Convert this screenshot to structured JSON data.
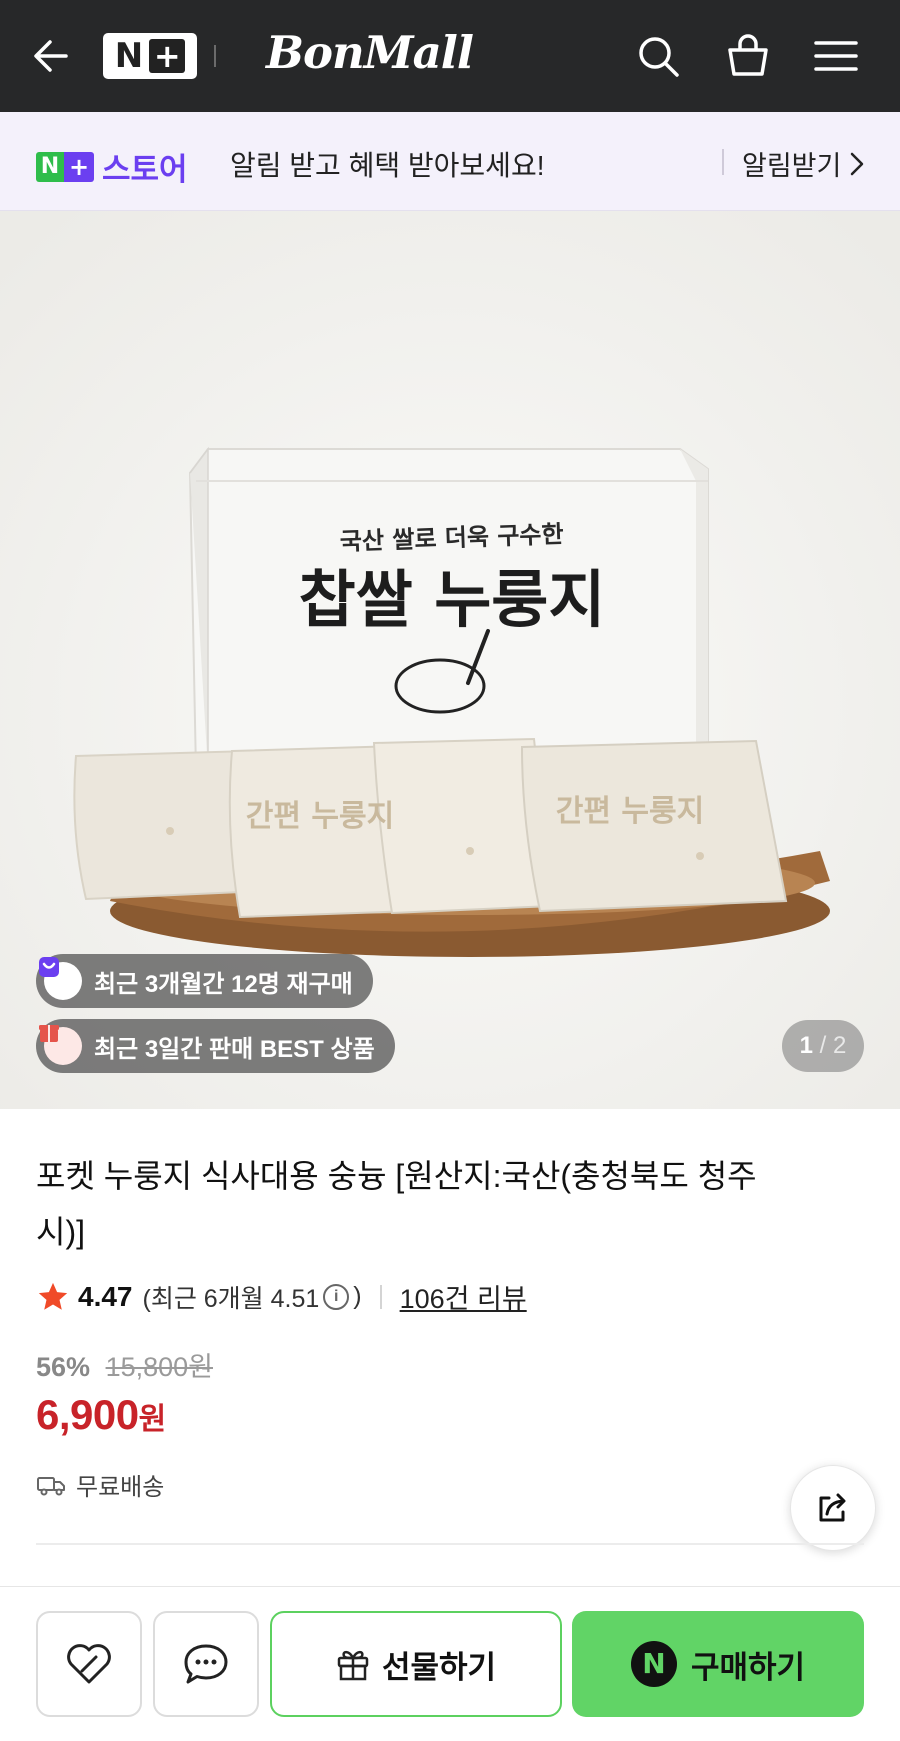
{
  "header": {
    "nplus_logo_n": "N",
    "nplus_logo_plus": "+",
    "brand": "BonMall"
  },
  "notice": {
    "store_n": "N",
    "store_plus": "+",
    "store_name": "스토어",
    "message": "알림 받고 혜택 받아보세요!",
    "cta": "알림받기"
  },
  "gallery": {
    "box_text_top": "국산 쌀로 더욱 구수한",
    "box_text_main": "찹쌀 누룽지",
    "pouch_text": "간편 누룽지",
    "badges": [
      {
        "label": "최근 3개월간 12명 재구매",
        "icon": "repurchase-bag-icon",
        "color": "#6b3ff0"
      },
      {
        "label": "최근 3일간 판매 BEST 상품",
        "icon": "gift-box-icon",
        "color": "#e5544b"
      }
    ],
    "page_current": "1",
    "page_total": "2"
  },
  "product": {
    "title": "포켓 누룽지 식사대용 숭늉 [원산지:국산(충청북도 청주시)]",
    "rating": "4.47",
    "rating_recent_prefix": "(최근 6개월 4.51",
    "rating_recent_suffix": ")",
    "review_count": "106건 리뷰",
    "discount_pct": "56%",
    "original_price": "15,800원",
    "price": "6,900",
    "price_unit": "원",
    "shipping": "무료배송"
  },
  "bottom_bar": {
    "gift_label": "선물하기",
    "buy_label": "구매하기",
    "npay_letter": "N",
    "accent_color": "#61d466"
  }
}
